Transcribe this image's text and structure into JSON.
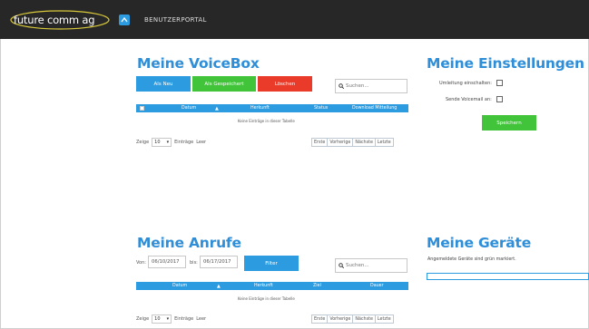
{
  "header": {
    "logo_text": "future comm ag",
    "nav_label": "BENUTZERPORTAL",
    "nav_icon": "portal-icon"
  },
  "voicebox": {
    "title": "Meine VoiceBox",
    "buttons": {
      "new": "Als Neu",
      "saved": "Als Gespeichert",
      "delete": "Löschen"
    },
    "search_placeholder": "Suchen...",
    "columns": [
      "Datum",
      "Herkunft",
      "Status",
      "Download Mitteilung"
    ],
    "empty_text": "Keine Einträge in dieser Tabelle",
    "show_prefix": "Zeige",
    "page_size": "10",
    "show_suffix": "Einträge",
    "empty_label": "Leer",
    "pager": [
      "Erste",
      "Vorherige",
      "Nächste",
      "Letzte"
    ]
  },
  "settings": {
    "title": "Meine Einstellungen",
    "forward_label": "Umleitung einschalten:",
    "voicemail_label": "Sende Voicemail an:",
    "save_label": "Speichern"
  },
  "calls": {
    "title": "Meine Anrufe",
    "from_label": "Von:",
    "from_date": "06/10/2017",
    "to_label": "bis:",
    "to_date": "06/17/2017",
    "filter_label": "Filter",
    "search_placeholder": "Suchen...",
    "columns": [
      "Datum",
      "Herkunft",
      "Ziel",
      "Dauer"
    ],
    "empty_text": "Keine Einträge in dieser Tabelle",
    "show_prefix": "Zeige",
    "page_size": "10",
    "show_suffix": "Einträge",
    "empty_label": "Leer",
    "pager": [
      "Erste",
      "Vorherige",
      "Nächste",
      "Letzte"
    ]
  },
  "devices": {
    "title": "Meine Geräte",
    "hint": "Angemeldete Geräte sind grün markiert."
  },
  "colors": {
    "accent": "#2d9be0",
    "title": "#2f8ed8",
    "green": "#41c33a",
    "red": "#e93a2a",
    "topbar": "#272727"
  }
}
